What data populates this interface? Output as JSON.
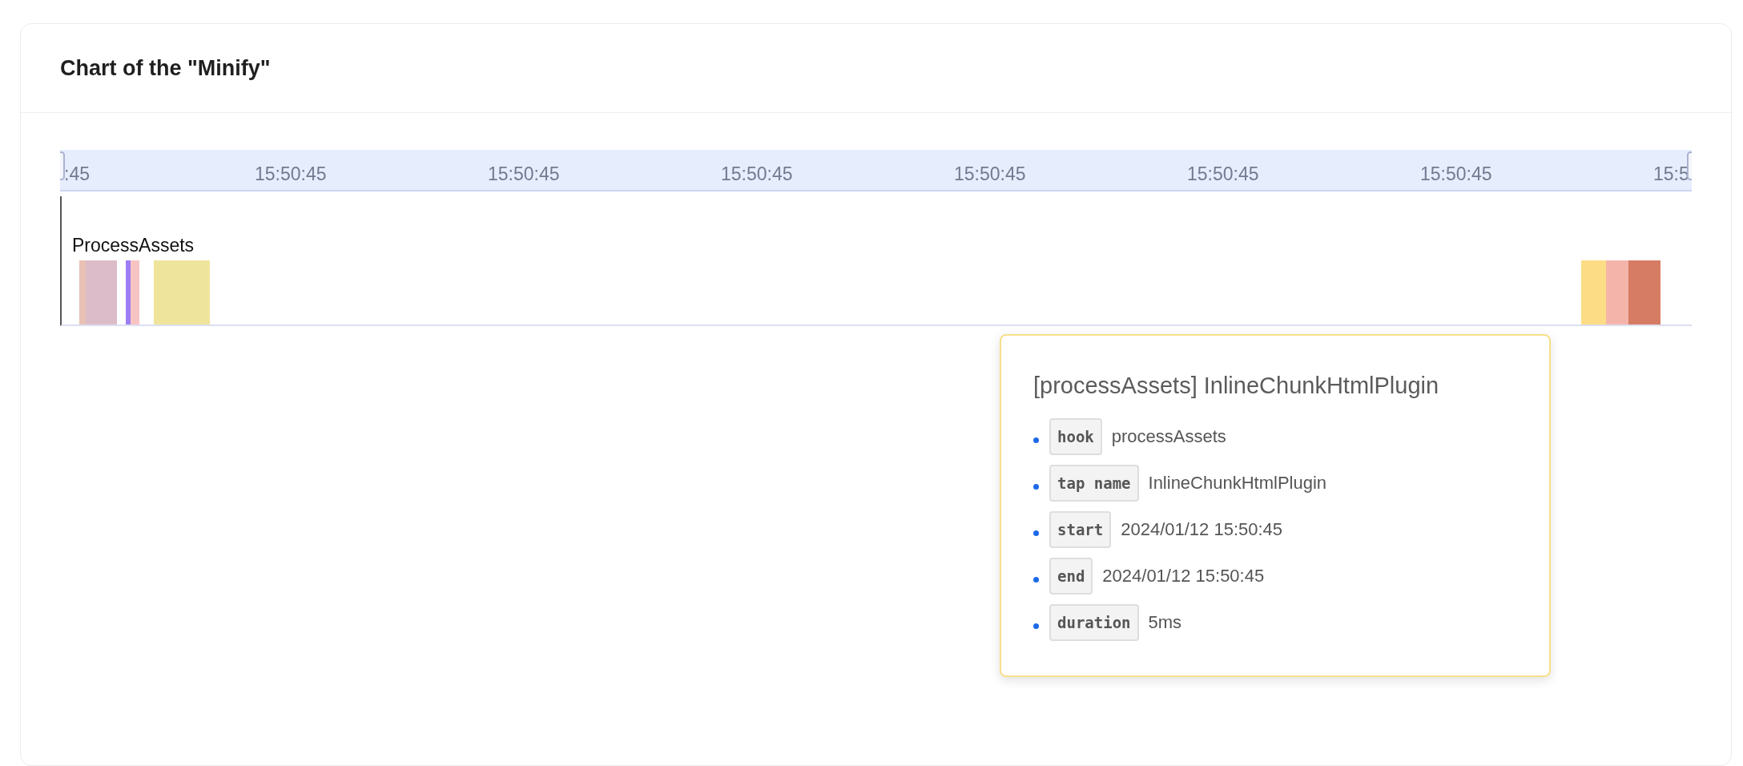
{
  "card": {
    "title": "Chart of the \"Minify\""
  },
  "timeline": {
    "ticks": [
      ":45",
      "15:50:45",
      "15:50:45",
      "15:50:45",
      "15:50:45",
      "15:50:45",
      "15:50:45",
      "15:5"
    ],
    "row_label": "ProcessAssets",
    "spans": [
      {
        "color": "#e8c0b4"
      },
      {
        "color": "#dcbcc8"
      },
      {
        "color": "#9d7ef4"
      },
      {
        "color": "#f7c4c4"
      },
      {
        "color": "#efe49c"
      },
      {
        "color": "#fcdc84"
      },
      {
        "color": "#f4b4aa"
      },
      {
        "color": "#d67c64"
      }
    ]
  },
  "tooltip": {
    "title": "[processAssets] InlineChunkHtmlPlugin",
    "fields": [
      {
        "key": "hook",
        "value": "processAssets"
      },
      {
        "key": "tap name",
        "value": "InlineChunkHtmlPlugin"
      },
      {
        "key": "start",
        "value": "2024/01/12 15:50:45"
      },
      {
        "key": "end",
        "value": "2024/01/12 15:50:45"
      },
      {
        "key": "duration",
        "value": "5ms"
      }
    ]
  }
}
